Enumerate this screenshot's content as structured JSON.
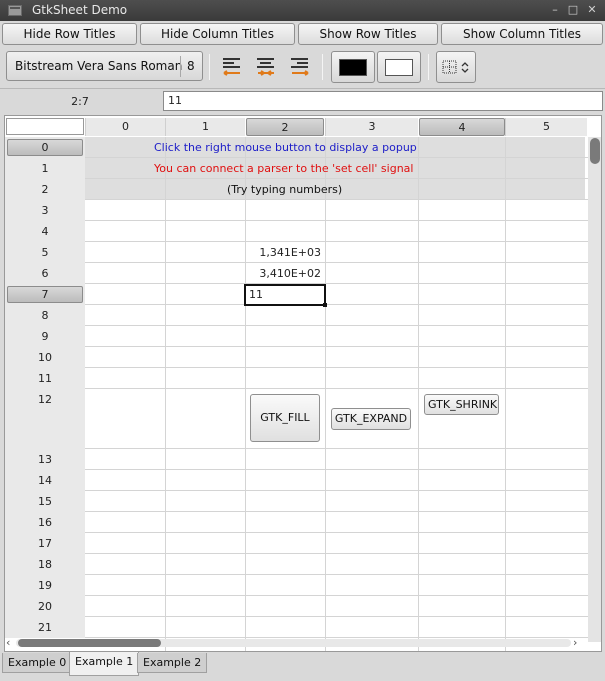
{
  "window": {
    "title": "GtkSheet Demo",
    "minimize_glyph": "–",
    "maximize_glyph": "□",
    "close_glyph": "✕"
  },
  "toolbar1": {
    "hide_row_titles": "Hide Row Titles",
    "hide_column_titles": "Hide Column Titles",
    "show_row_titles": "Show Row Titles",
    "show_column_titles": "Show Column Titles"
  },
  "toolbar2": {
    "font_name": "Bitstream Vera Sans Roman",
    "font_size": "8",
    "foreground_color": "#000000",
    "background_color": "#ffffff",
    "align_icon_color": "#e07a1a"
  },
  "entry": {
    "cell_ref": "2:7",
    "value": "11"
  },
  "sheet": {
    "columns": [
      "0",
      "1",
      "2",
      "3",
      "4",
      "5"
    ],
    "rows": [
      "0",
      "1",
      "2",
      "3",
      "4",
      "5",
      "6",
      "7",
      "8",
      "9",
      "10",
      "11",
      "12",
      "13",
      "14",
      "15",
      "16",
      "17",
      "18",
      "19",
      "20",
      "21"
    ],
    "messages": {
      "popup_hint": "Click the right mouse button to display a popup",
      "parser_hint": "You can connect a parser to the 'set cell' signal",
      "typing_hint": "(Try typing numbers)",
      "popup_hint_color": "#1c1cc8",
      "parser_hint_color": "#e01010"
    },
    "values": {
      "r5c2": "1,341E+03",
      "r6c2": "3,410E+02",
      "r7c2": "11"
    },
    "buttons": {
      "fill": "GTK_FILL",
      "expand": "GTK_EXPAND",
      "shrink": "GTK_SHRINK"
    }
  },
  "tabs": [
    "Example 0",
    "Example 1",
    "Example 2"
  ]
}
